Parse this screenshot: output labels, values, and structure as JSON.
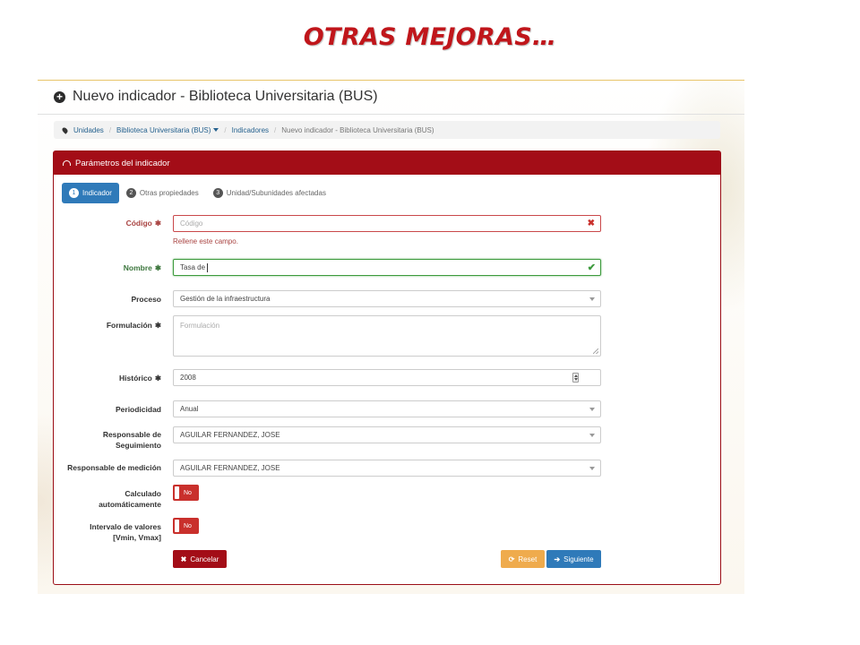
{
  "slide": {
    "title": "OTRAS MEJORAS…"
  },
  "page": {
    "heading": "Nuevo indicador - Biblioteca Universitaria (BUS)"
  },
  "breadcrumb": {
    "items": [
      "Unidades",
      "Biblioteca Universitaria (BUS)",
      "Indicadores",
      "Nuevo indicador - Biblioteca Universitaria (BUS)"
    ]
  },
  "panel": {
    "title": "Parámetros del indicador"
  },
  "wizard": {
    "steps": [
      {
        "num": "1",
        "label": "Indicador"
      },
      {
        "num": "2",
        "label": "Otras propiedades"
      },
      {
        "num": "3",
        "label": "Unidad/Subunidades afectadas"
      }
    ]
  },
  "form": {
    "codigo": {
      "label": "Código",
      "placeholder": "Código",
      "value": "",
      "error": "Rellene este campo."
    },
    "nombre": {
      "label": "Nombre",
      "value": "Tasa de"
    },
    "proceso": {
      "label": "Proceso",
      "value": "Gestión de la infraestructura"
    },
    "formulacion": {
      "label": "Formulación",
      "placeholder": "Formulación"
    },
    "historico": {
      "label": "Histórico",
      "value": "2008"
    },
    "periodicidad": {
      "label": "Periodicidad",
      "value": "Anual"
    },
    "resp_seguimiento": {
      "label_line1": "Responsable de",
      "label_line2": "Seguimiento",
      "value": "AGUILAR FERNANDEZ, JOSE"
    },
    "resp_medicion": {
      "label": "Responsable de medición",
      "value": "AGUILAR FERNANDEZ, JOSE"
    },
    "calculado": {
      "label_line1": "Calculado",
      "label_line2": "automáticamente",
      "value": "No"
    },
    "intervalo": {
      "label_line1": "Intervalo de valores",
      "label_line2": "[Vmin, Vmax]",
      "value": "No"
    },
    "required_mark": "✱"
  },
  "buttons": {
    "cancel": "Cancelar",
    "reset": "Reset",
    "next": "Siguiente"
  },
  "colors": {
    "brand_red": "#a30d17",
    "primary_blue": "#2f7ab9",
    "warning_orange": "#efab4d",
    "error": "#a94442",
    "success": "#3c763d"
  },
  "icons": {
    "heading": "plus-circle-icon",
    "breadcrumb": "map-marker-icon",
    "panel": "dashboard-icon"
  }
}
